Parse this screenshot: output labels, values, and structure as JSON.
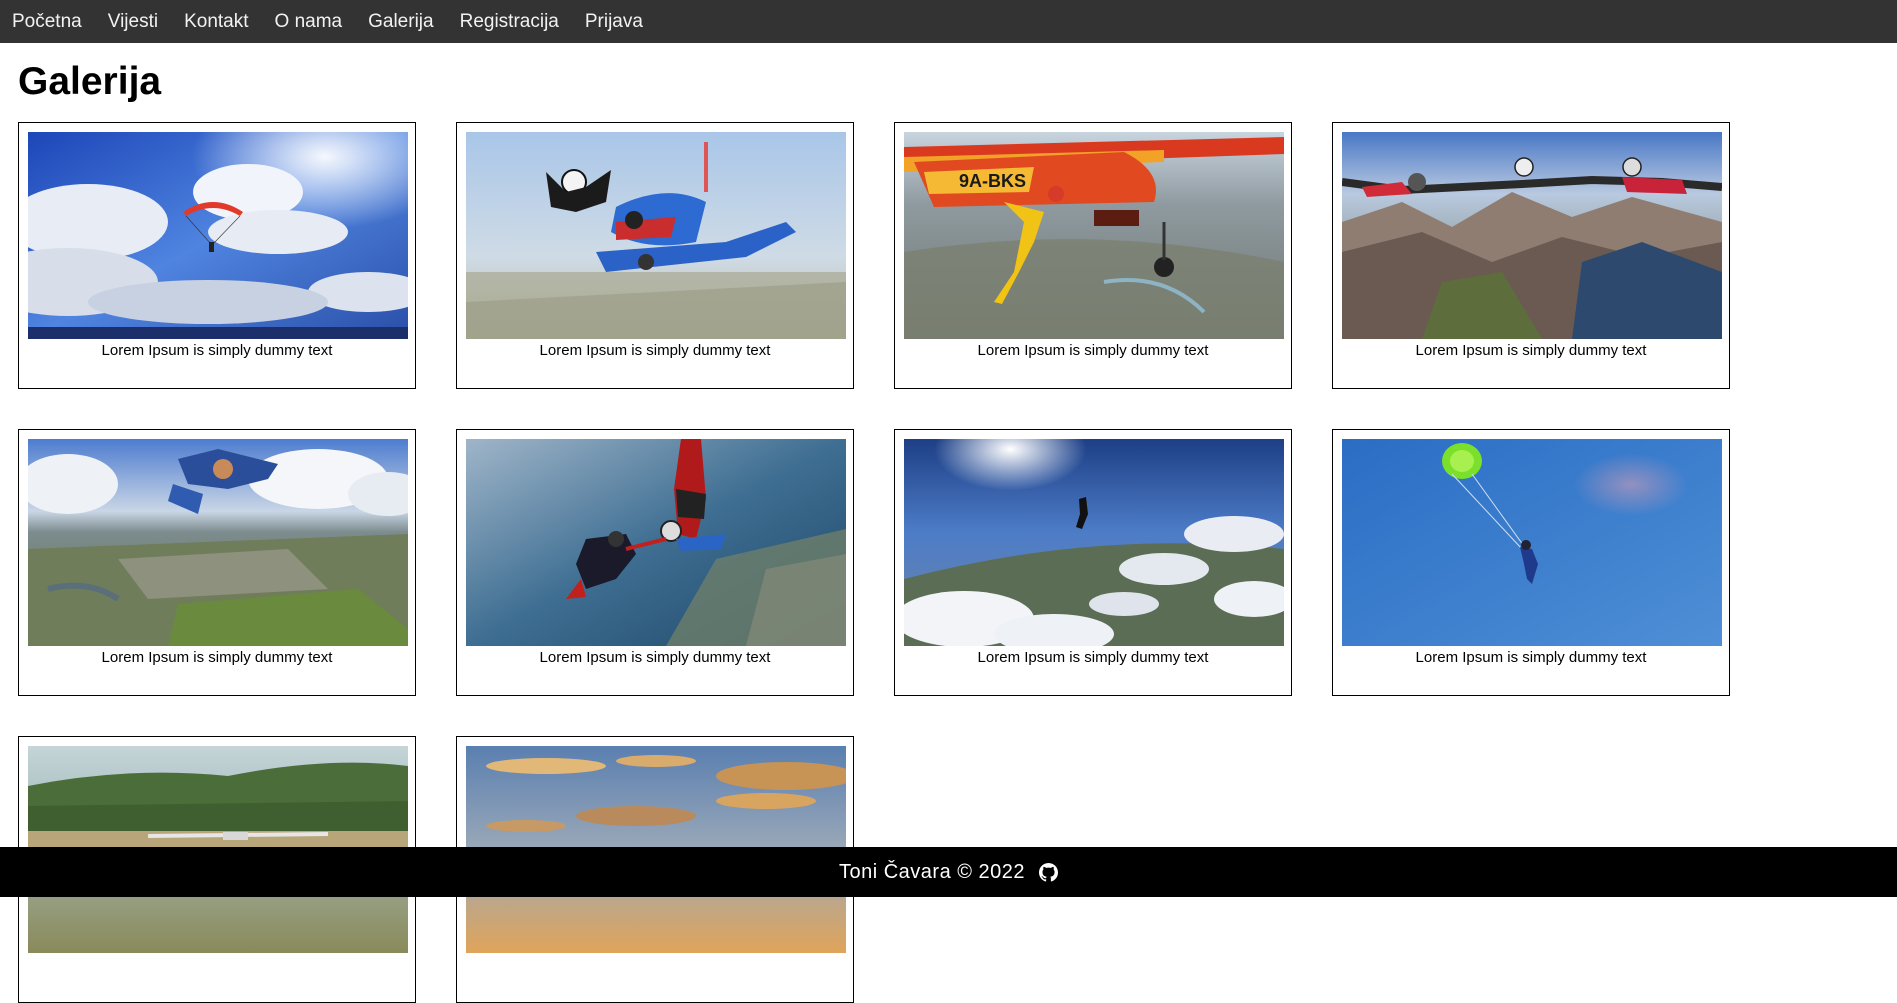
{
  "nav": {
    "items": [
      {
        "label": "Početna"
      },
      {
        "label": "Vijesti"
      },
      {
        "label": "Kontakt"
      },
      {
        "label": "O nama"
      },
      {
        "label": "Galerija"
      },
      {
        "label": "Registracija"
      },
      {
        "label": "Prijava"
      }
    ]
  },
  "page": {
    "title": "Galerija"
  },
  "gallery": {
    "items": [
      {
        "caption": "Lorem Ipsum is simply dummy text",
        "icon": "parachute-sky-photo"
      },
      {
        "caption": "Lorem Ipsum is simply dummy text",
        "icon": "tandem-skydivers-photo"
      },
      {
        "caption": "Lorem Ipsum is simply dummy text",
        "icon": "plane-jump-photo",
        "plane_text": "9A-BKS"
      },
      {
        "caption": "Lorem Ipsum is simply dummy text",
        "icon": "formation-mountains-photo"
      },
      {
        "caption": "Lorem Ipsum is simply dummy text",
        "icon": "freefall-city-photo"
      },
      {
        "caption": "Lorem Ipsum is simply dummy text",
        "icon": "duo-freefall-coast-photo"
      },
      {
        "caption": "Lorem Ipsum is simply dummy text",
        "icon": "solo-above-clouds-photo"
      },
      {
        "caption": "Lorem Ipsum is simply dummy text",
        "icon": "green-canopy-photo"
      },
      {
        "caption": "",
        "icon": "airfield-plane-photo"
      },
      {
        "caption": "",
        "icon": "sunset-clouds-photo"
      }
    ]
  },
  "footer": {
    "text": "Toni Čavara © 2022",
    "icon": "github-icon"
  },
  "colors": {
    "navbar": "#333333",
    "nav_text": "#f2f2f2",
    "footer": "#000000",
    "sky": "#3b6fd1"
  }
}
